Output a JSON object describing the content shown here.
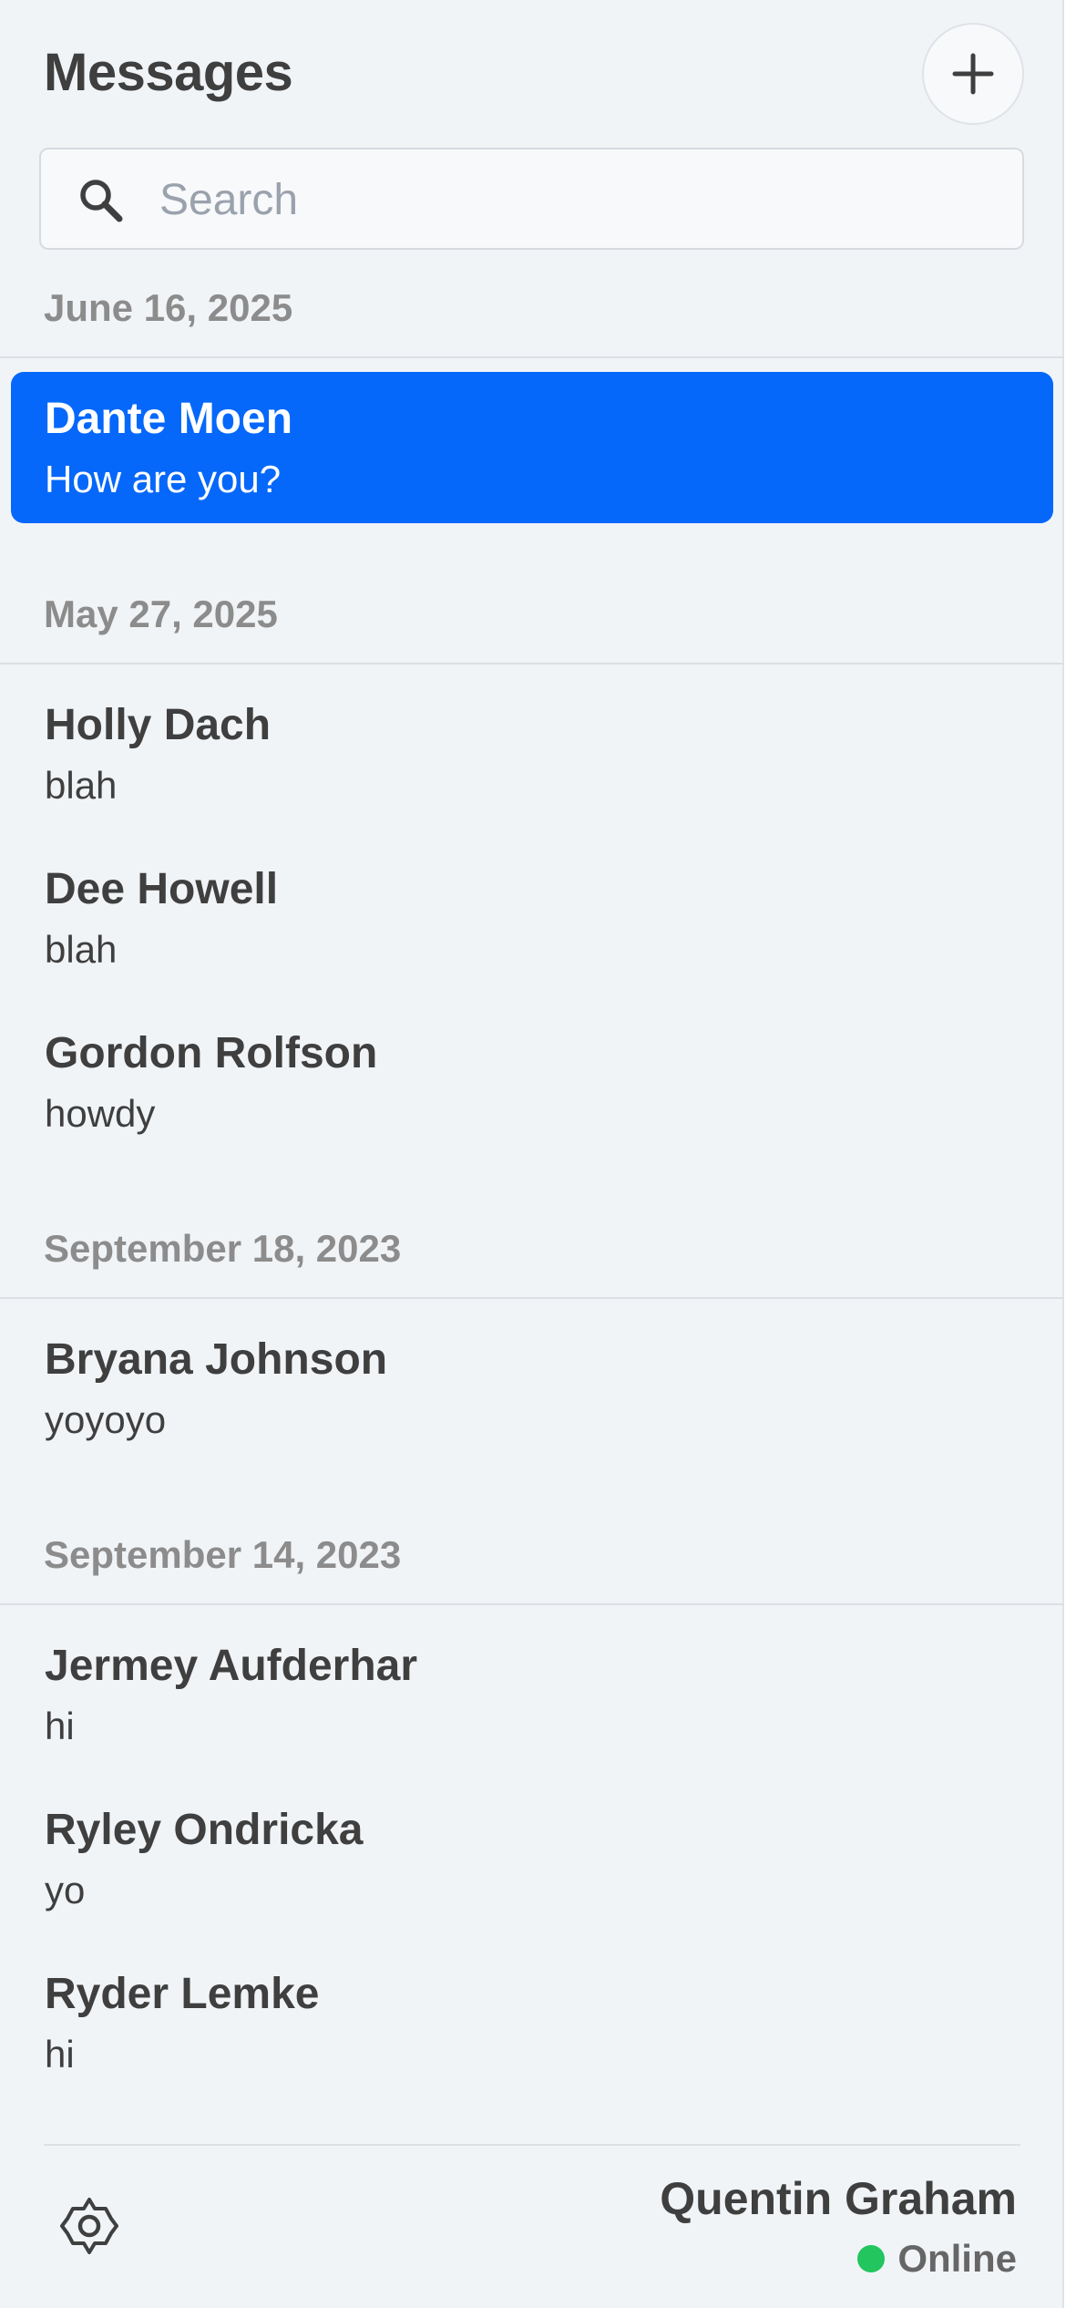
{
  "header": {
    "title": "Messages",
    "new_button_icon": "plus-icon"
  },
  "search": {
    "placeholder": "Search",
    "value": "",
    "icon": "search-icon"
  },
  "groups": [
    {
      "date": "June 16, 2025",
      "conversations": [
        {
          "name": "Dante Moen",
          "preview": "How are you?",
          "selected": true
        }
      ]
    },
    {
      "date": "May 27, 2025",
      "conversations": [
        {
          "name": "Holly Dach",
          "preview": "blah"
        },
        {
          "name": "Dee Howell",
          "preview": "blah"
        },
        {
          "name": "Gordon Rolfson",
          "preview": "howdy"
        }
      ]
    },
    {
      "date": "September 18, 2023",
      "conversations": [
        {
          "name": "Bryana Johnson",
          "preview": "yoyoyo"
        }
      ]
    },
    {
      "date": "September 14, 2023",
      "conversations": [
        {
          "name": "Jermey Aufderhar",
          "preview": "hi"
        },
        {
          "name": "Ryley Ondricka",
          "preview": "yo"
        },
        {
          "name": "Ryder Lemke",
          "preview": "hi"
        }
      ]
    }
  ],
  "footer": {
    "settings_icon": "gear-icon",
    "user_name": "Quentin Graham",
    "status_text": "Online",
    "status_color": "#22c55e"
  },
  "colors": {
    "accent": "#0668fa",
    "background": "#f1f4f7",
    "text": "#3f3f3f",
    "muted": "#8c8c8c"
  }
}
